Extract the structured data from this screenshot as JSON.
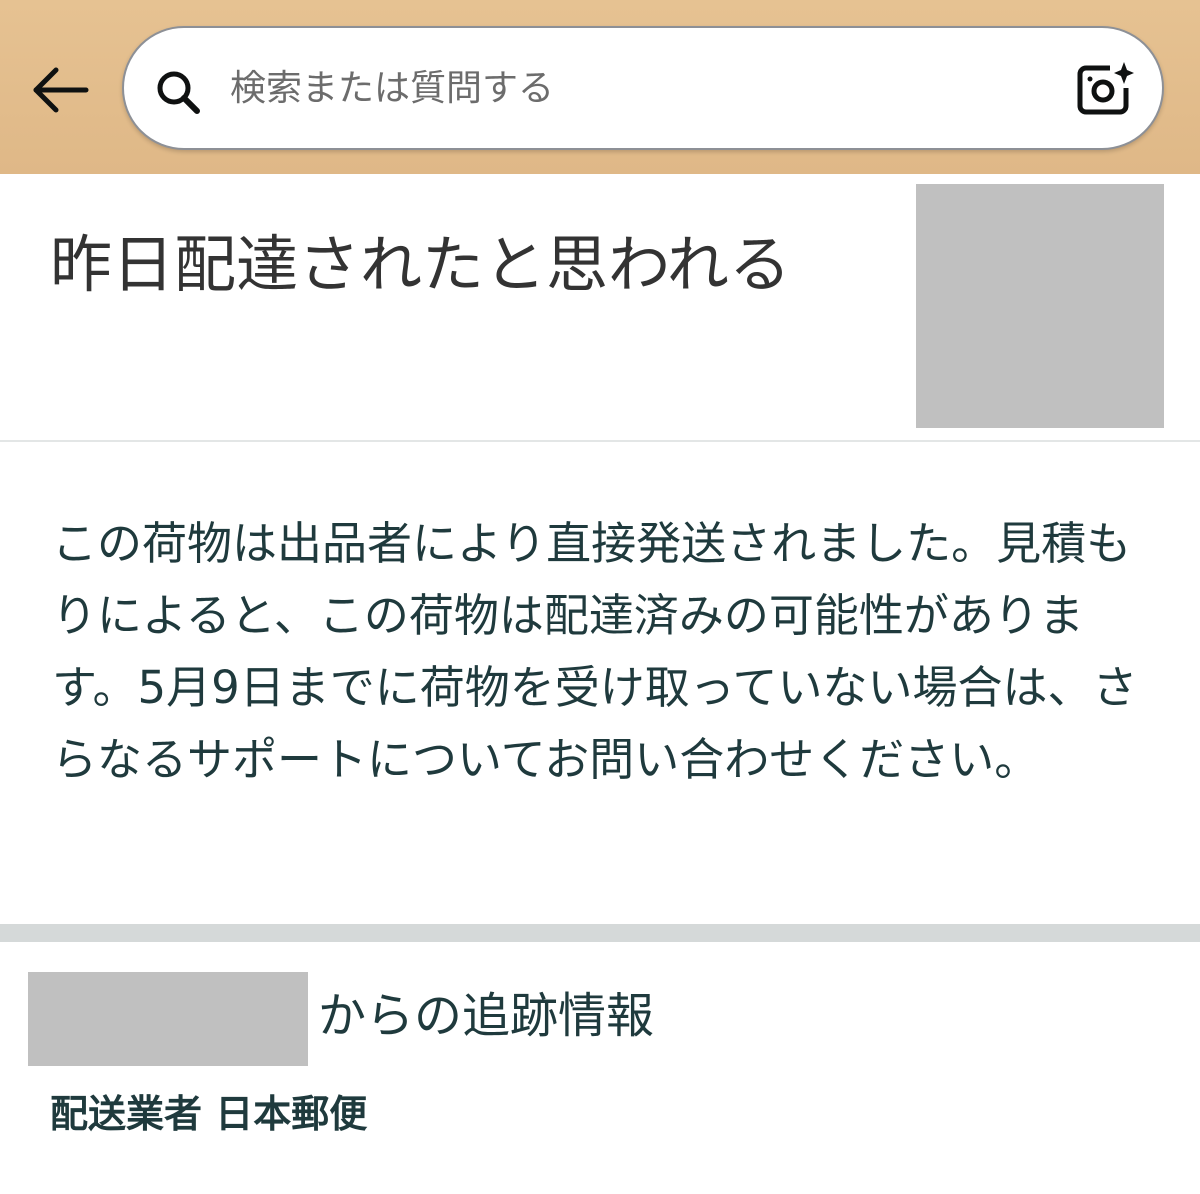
{
  "header": {
    "back_icon": "arrow-left-icon",
    "search": {
      "placeholder": "検索または質問する",
      "value": "",
      "search_icon": "search-icon",
      "camera_icon": "camera-sparkle-icon"
    },
    "background_color": "#e2bc8c"
  },
  "delivery_status": {
    "title": "昨日配達されたと思われる"
  },
  "message": {
    "text": "この荷物は出品者により直接発送されました。見積もりによると、この荷物は配達済みの可能性があります。5月9日までに荷物を受け取っていない場合は、さらなるサポートについてお問い合わせください。"
  },
  "tracking": {
    "title_suffix": "からの追跡情報",
    "carrier": "配送業者 日本郵便"
  },
  "colors": {
    "text_primary": "#1f3a3d",
    "redaction": "#c0c0c0",
    "divider": "#d5d9d9"
  }
}
